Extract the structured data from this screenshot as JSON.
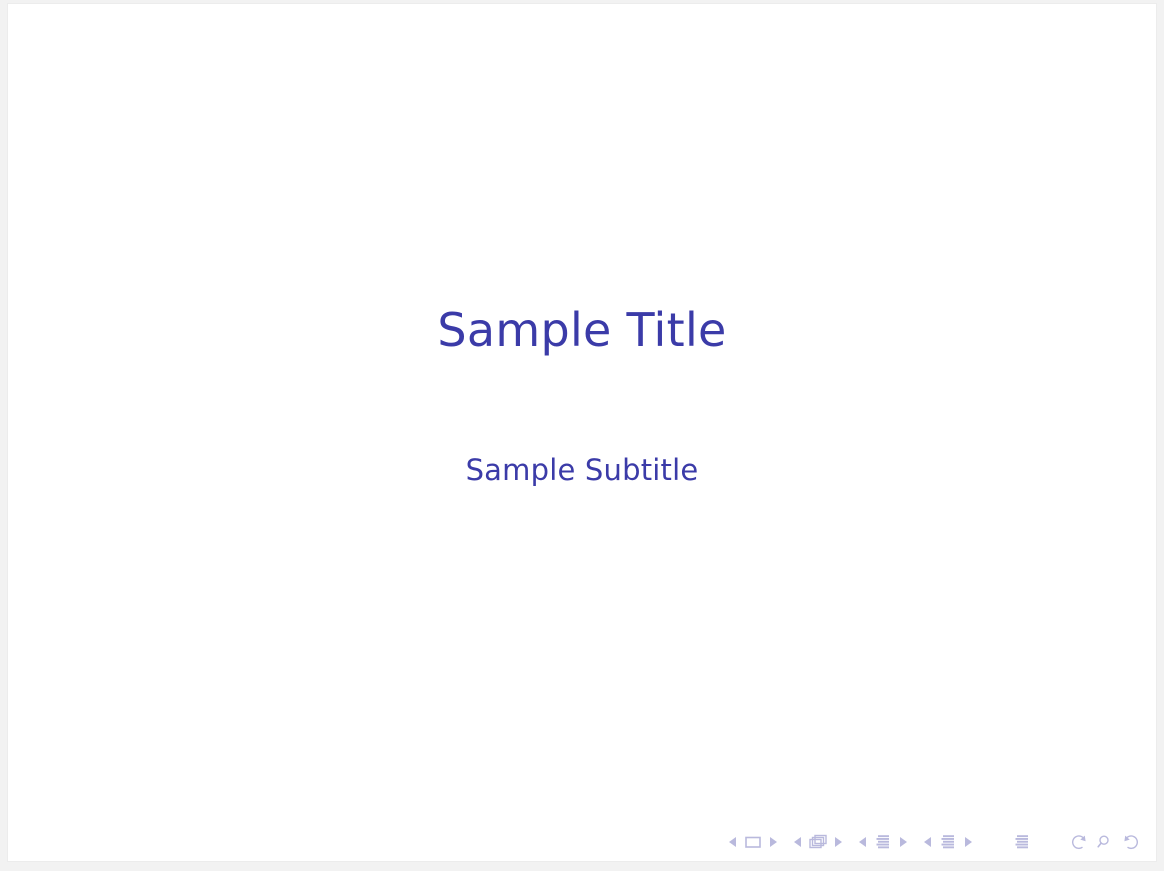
{
  "document": {
    "type": "presentation-slide",
    "background_color": "#f2f2f2",
    "slide_color": "#ffffff"
  },
  "slide": {
    "title": "Sample Title",
    "subtitle": "Sample Subtitle",
    "text_color": "#3b3ba8"
  },
  "navigation": {
    "color": "#b9b9dd",
    "groups": [
      {
        "name": "slide",
        "prev_label": "Previous slide",
        "icon_label": "slide",
        "next_label": "Next slide"
      },
      {
        "name": "frame",
        "prev_label": "Previous frame",
        "icon_label": "frames",
        "next_label": "Next frame"
      },
      {
        "name": "subsection",
        "prev_label": "Previous subsection",
        "icon_label": "subsection",
        "next_label": "Next subsection"
      },
      {
        "name": "section",
        "prev_label": "Previous section",
        "icon_label": "section",
        "next_label": "Next section"
      },
      {
        "name": "presentation",
        "icon_label": "presentation"
      },
      {
        "name": "history",
        "back_label": "Go back",
        "search_label": "Search",
        "forward_label": "Go forward"
      }
    ]
  }
}
